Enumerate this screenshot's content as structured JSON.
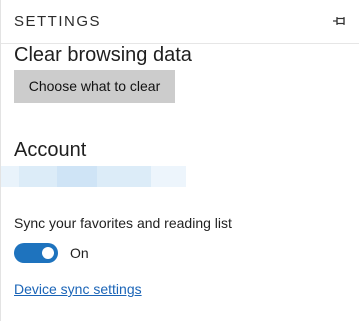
{
  "header": {
    "title": "SETTINGS",
    "pin_icon": "pin-icon"
  },
  "clear_browsing": {
    "title": "Clear browsing data",
    "button_label": "Choose what to clear"
  },
  "account": {
    "title": "Account",
    "redacted_colors": [
      "#e9f3fb",
      "#dcecf8",
      "#cfe4f6",
      "#dcecf8",
      "#edf5fc"
    ]
  },
  "sync": {
    "label": "Sync your favorites and reading list",
    "toggle_state": "On",
    "toggle_on": true,
    "link_label": "Device sync settings"
  },
  "colors": {
    "accent": "#1e73be",
    "link": "#1a64b7",
    "button_bg": "#cccccc"
  }
}
